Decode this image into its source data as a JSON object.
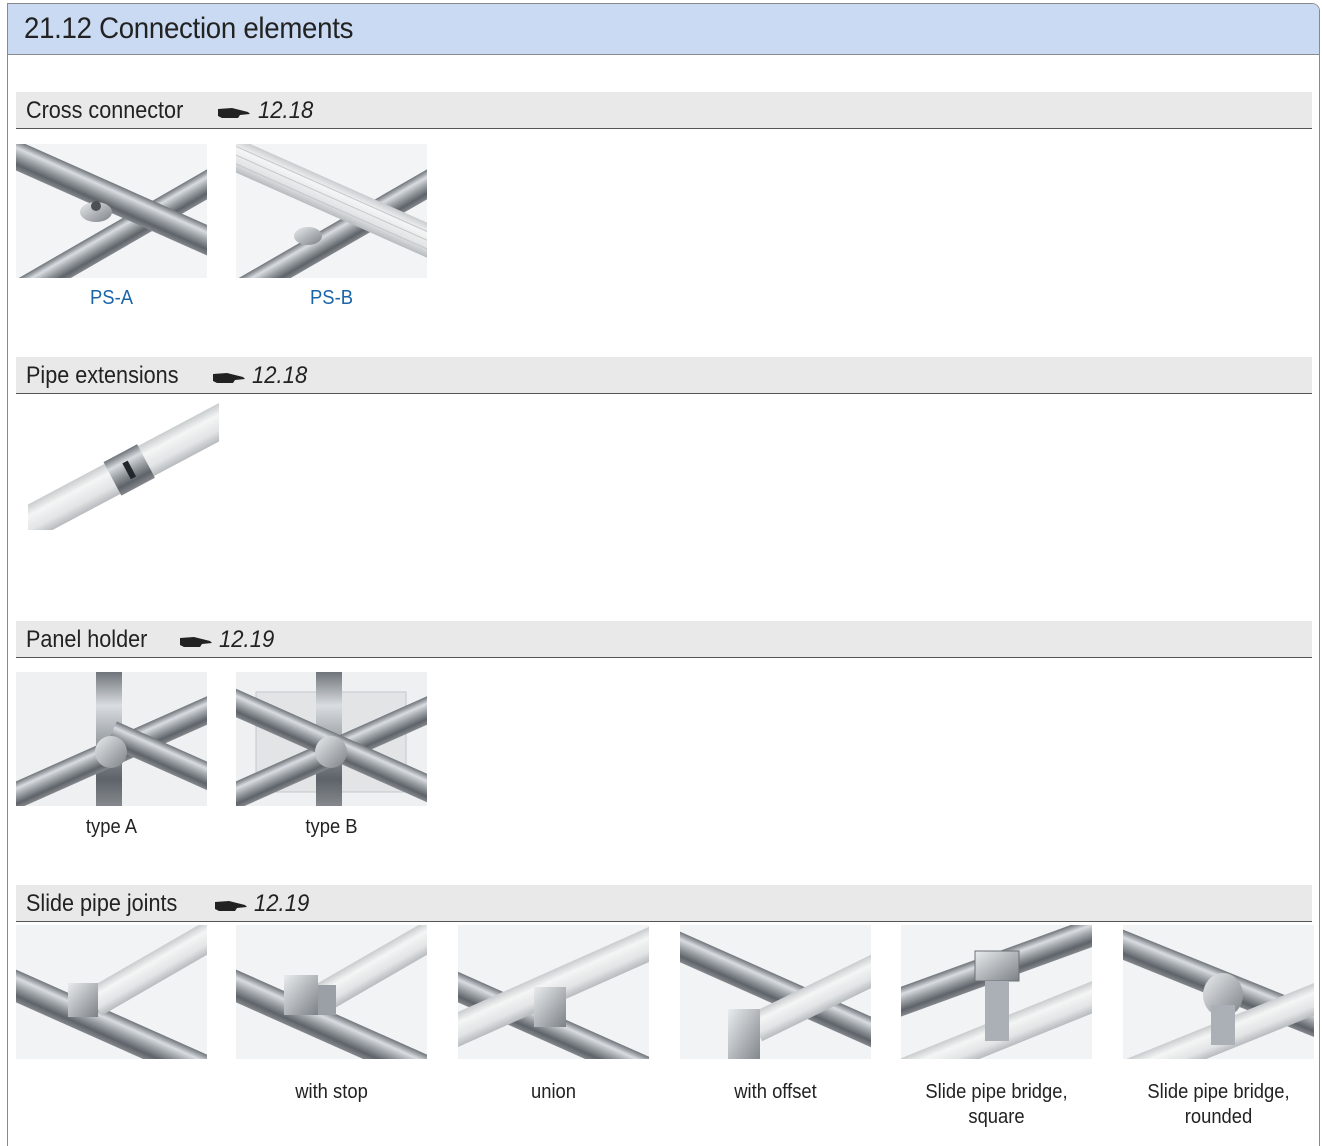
{
  "title": "21.12  Connection elements",
  "sections": [
    {
      "label": "Cross connector",
      "ref": "12.18",
      "items": [
        "PS-A",
        "PS-B"
      ]
    },
    {
      "label": "Pipe extensions",
      "ref": "12.18",
      "items": []
    },
    {
      "label": "Panel holder",
      "ref": "12.19",
      "items": [
        "type A",
        "type B"
      ]
    },
    {
      "label": "Slide pipe joints",
      "ref": "12.19",
      "items": [
        "",
        "with stop",
        "union",
        "with offset",
        "Slide pipe bridge,\nsquare",
        "Slide pipe bridge,\nrounded"
      ]
    }
  ],
  "icons": {
    "reference": "pointing-hand-icon"
  },
  "colors": {
    "title_bg": "#c9daf2",
    "section_bg": "#e9e9e9",
    "caption_link": "#1a64a8"
  }
}
